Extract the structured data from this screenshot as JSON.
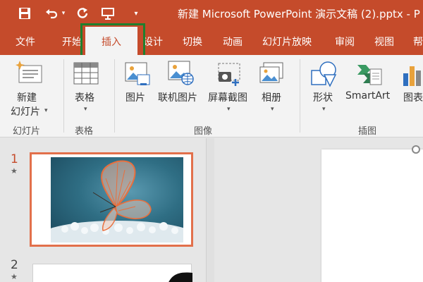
{
  "titlebar": {
    "title": "新建 Microsoft PowerPoint 演示文稿 (2).pptx - P"
  },
  "tabs": [
    {
      "label": "文件"
    },
    {
      "label": "开始"
    },
    {
      "label": "插入"
    },
    {
      "label": "设计"
    },
    {
      "label": "切换"
    },
    {
      "label": "动画"
    },
    {
      "label": "幻灯片放映"
    },
    {
      "label": "审阅"
    },
    {
      "label": "视图"
    },
    {
      "label": "帮"
    }
  ],
  "ribbon": {
    "new_slide": {
      "line1": "新建",
      "line2": "幻灯片"
    },
    "table": "表格",
    "picture": "图片",
    "online_picture": "联机图片",
    "screenshot": "屏幕截图",
    "album": "相册",
    "shapes": "形状",
    "smartart": "SmartArt",
    "chart": "图表",
    "groups": {
      "slides": "幻灯片",
      "tables": "表格",
      "images": "图像",
      "illustrations": "插图"
    }
  },
  "slides": [
    {
      "number": "1"
    },
    {
      "number": "2"
    }
  ],
  "colors": {
    "accent": "#c54b2b",
    "highlight_box": "#1f7f2e",
    "selected_thumb_border": "#e2704b"
  }
}
